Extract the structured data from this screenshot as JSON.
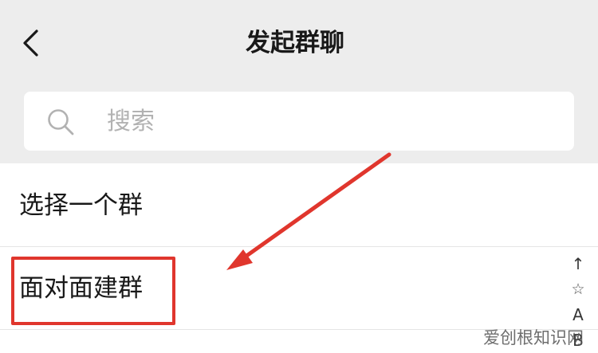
{
  "header": {
    "title": "发起群聊",
    "background_color": "#ededed"
  },
  "icons": {
    "back": "chevron-left-icon",
    "search": "search-icon"
  },
  "search": {
    "placeholder": "搜索",
    "value": ""
  },
  "list": {
    "items": [
      {
        "label": "选择一个群"
      },
      {
        "label": "面对面建群"
      }
    ]
  },
  "index_bar": {
    "entries": [
      "↑",
      "☆",
      "A",
      "B"
    ]
  },
  "annotation": {
    "highlight_color": "#e0362d"
  },
  "watermark": {
    "text": "爱创根知识网"
  }
}
